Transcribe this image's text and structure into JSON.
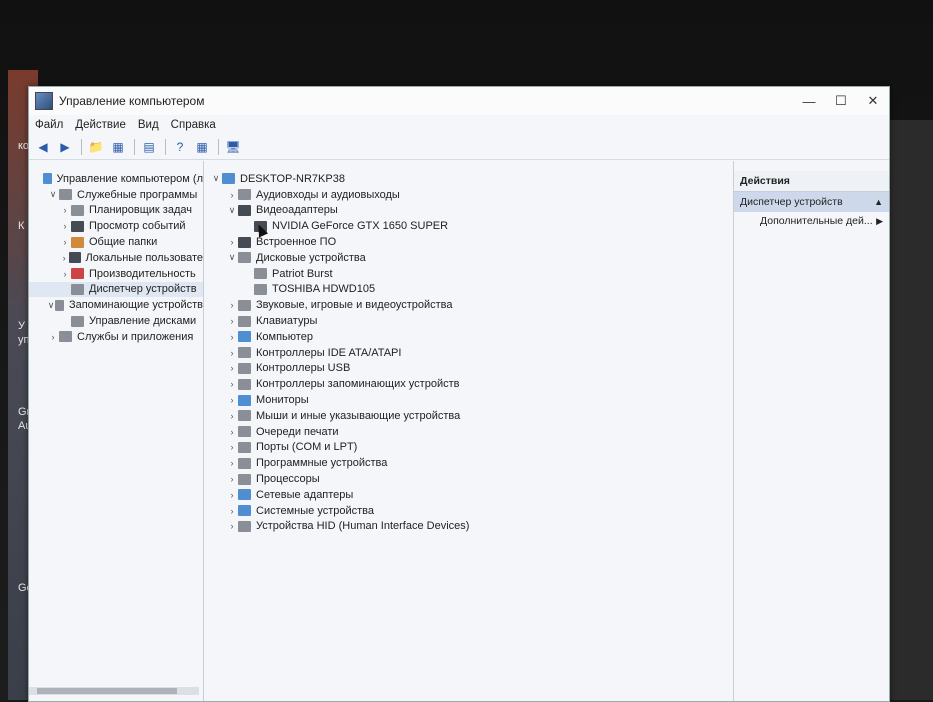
{
  "window": {
    "title": "Управление компьютером",
    "controls": [
      "minimize-icon",
      "maximize-icon",
      "close-icon"
    ]
  },
  "menu": [
    "Файл",
    "Действие",
    "Вид",
    "Справка"
  ],
  "left_tree": [
    {
      "label": "Управление компьютером (л",
      "icon": "computer-icon",
      "level": 0,
      "chev": ""
    },
    {
      "label": "Служебные программы",
      "icon": "tools-icon",
      "level": 1,
      "chev": "v"
    },
    {
      "label": "Планировщик задач",
      "icon": "clock-icon",
      "level": 2,
      "chev": ">"
    },
    {
      "label": "Просмотр событий",
      "icon": "event-viewer-icon",
      "level": 2,
      "chev": ">"
    },
    {
      "label": "Общие папки",
      "icon": "folder-icon",
      "level": 2,
      "chev": ">"
    },
    {
      "label": "Локальные пользовате",
      "icon": "users-icon",
      "level": 2,
      "chev": ">"
    },
    {
      "label": "Производительность",
      "icon": "performance-icon",
      "level": 2,
      "chev": ">"
    },
    {
      "label": "Диспетчер устройств",
      "icon": "device-manager-icon",
      "level": 2,
      "chev": "",
      "selected": true
    },
    {
      "label": "Запоминающие устройств",
      "icon": "storage-icon",
      "level": 1,
      "chev": "v"
    },
    {
      "label": "Управление дисками",
      "icon": "disk-icon",
      "level": 2,
      "chev": ""
    },
    {
      "label": "Службы и приложения",
      "icon": "services-icon",
      "level": 1,
      "chev": ">"
    }
  ],
  "device_tree": [
    {
      "label": "DESKTOP-NR7KP38",
      "level": 0,
      "chev": "v",
      "icon": "computer-icon"
    },
    {
      "label": "Аудиовходы и аудиовыходы",
      "level": 1,
      "chev": ">",
      "icon": "audio-icon"
    },
    {
      "label": "Видеоадаптеры",
      "level": 1,
      "chev": "v",
      "icon": "display-adapter-icon"
    },
    {
      "label": "NVIDIA GeForce GTX 1650 SUPER",
      "level": 2,
      "chev": "",
      "icon": "display-adapter-icon"
    },
    {
      "label": "Встроенное ПО",
      "level": 1,
      "chev": ">",
      "icon": "firmware-icon"
    },
    {
      "label": "Дисковые устройства",
      "level": 1,
      "chev": "v",
      "icon": "disk-drive-icon"
    },
    {
      "label": "Patriot Burst",
      "level": 2,
      "chev": "",
      "icon": "disk-drive-icon"
    },
    {
      "label": "TOSHIBA HDWD105",
      "level": 2,
      "chev": "",
      "icon": "disk-drive-icon"
    },
    {
      "label": "Звуковые, игровые и видеоустройства",
      "level": 1,
      "chev": ">",
      "icon": "sound-icon"
    },
    {
      "label": "Клавиатуры",
      "level": 1,
      "chev": ">",
      "icon": "keyboard-icon"
    },
    {
      "label": "Компьютер",
      "level": 1,
      "chev": ">",
      "icon": "computer-icon"
    },
    {
      "label": "Контроллеры IDE ATA/ATAPI",
      "level": 1,
      "chev": ">",
      "icon": "ide-icon"
    },
    {
      "label": "Контроллеры USB",
      "level": 1,
      "chev": ">",
      "icon": "usb-icon"
    },
    {
      "label": "Контроллеры запоминающих устройств",
      "level": 1,
      "chev": ">",
      "icon": "storage-controller-icon"
    },
    {
      "label": "Мониторы",
      "level": 1,
      "chev": ">",
      "icon": "monitor-icon"
    },
    {
      "label": "Мыши и иные указывающие устройства",
      "level": 1,
      "chev": ">",
      "icon": "mouse-icon"
    },
    {
      "label": "Очереди печати",
      "level": 1,
      "chev": ">",
      "icon": "printer-icon"
    },
    {
      "label": "Порты (COM и LPT)",
      "level": 1,
      "chev": ">",
      "icon": "port-icon"
    },
    {
      "label": "Программные устройства",
      "level": 1,
      "chev": ">",
      "icon": "software-device-icon"
    },
    {
      "label": "Процессоры",
      "level": 1,
      "chev": ">",
      "icon": "processor-icon"
    },
    {
      "label": "Сетевые адаптеры",
      "level": 1,
      "chev": ">",
      "icon": "network-adapter-icon"
    },
    {
      "label": "Системные устройства",
      "level": 1,
      "chev": ">",
      "icon": "system-device-icon"
    },
    {
      "label": "Устройства HID (Human Interface Devices)",
      "level": 1,
      "chev": ">",
      "icon": "hid-icon"
    }
  ],
  "actions": {
    "header": "Действия",
    "section": "Диспетчер устройств",
    "more": "Дополнительные дей..."
  },
  "desktop_labels": [
    "ко",
    "К",
    "У",
    "упр",
    "Gr",
    "Au",
    "Go"
  ]
}
